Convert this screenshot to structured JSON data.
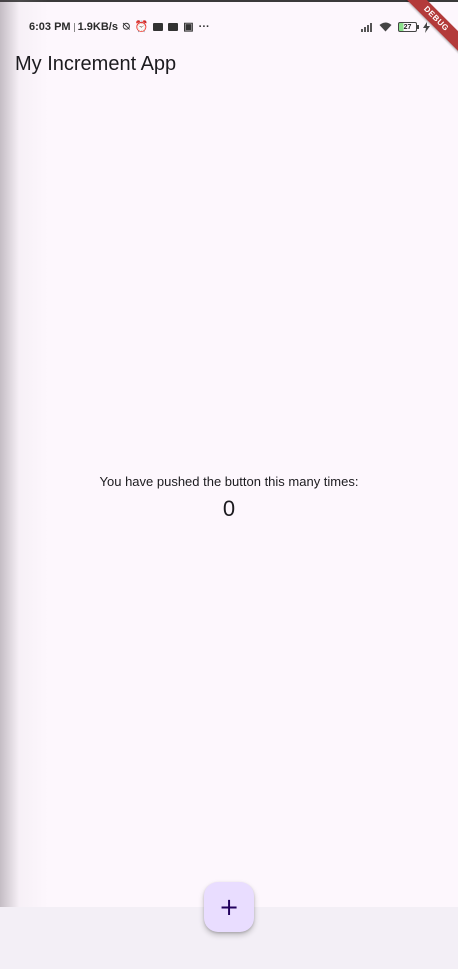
{
  "status_bar": {
    "time": "6:03 PM",
    "net_speed": "1.9KB/s",
    "battery_level": "27",
    "icons": [
      "alarm-off-icon",
      "alarm-icon",
      "message-icon",
      "message-icon",
      "cast-icon",
      "more-icon",
      "signal-icon",
      "wifi-icon",
      "battery-icon",
      "charging-icon"
    ]
  },
  "debug_banner": "DEBUG",
  "app_bar": {
    "title": "My Increment App"
  },
  "counter": {
    "label": "You have pushed the button this many times:",
    "value": "0"
  },
  "fab": {
    "icon": "add-icon",
    "symbol": "+"
  },
  "colors": {
    "background": "#fdf7fd",
    "fab_background": "#e9ddff",
    "fab_icon": "#21005d",
    "debug_banner": "#b33a3a",
    "text": "#1c1b1f"
  }
}
